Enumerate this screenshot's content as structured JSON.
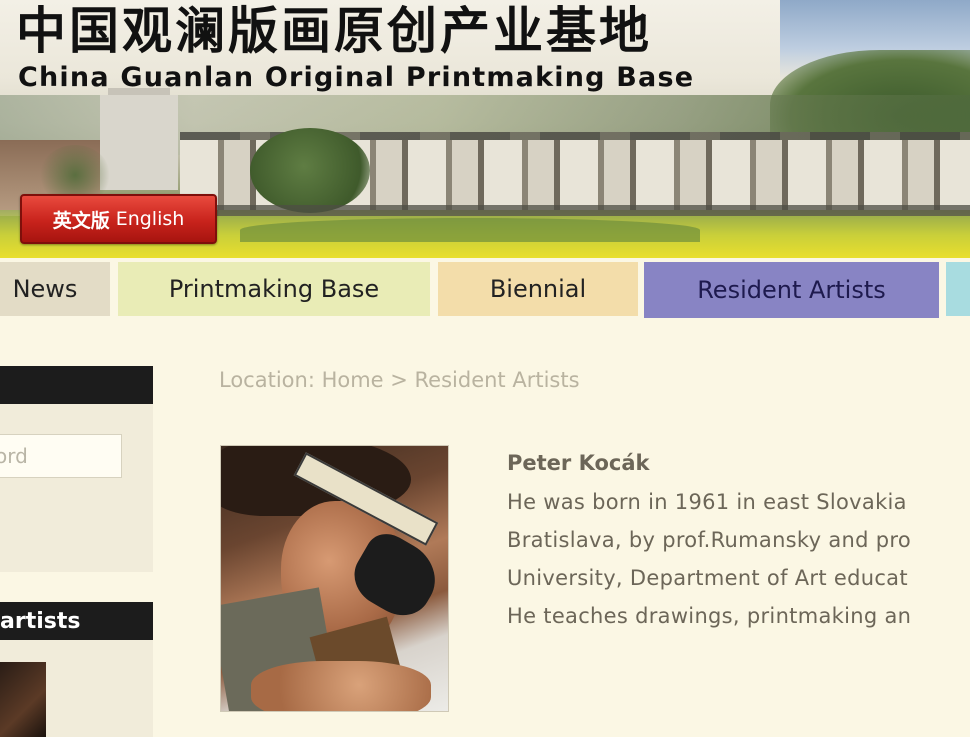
{
  "header": {
    "title_cn": "中国观澜版画原创产业基地",
    "title_en": "China Guanlan Original Printmaking Base",
    "language_button": {
      "cn": "英文版",
      "en": "English"
    }
  },
  "nav": {
    "tabs": [
      {
        "label": "News",
        "color": "#e3dcc6"
      },
      {
        "label": "Printmaking Base",
        "color": "#e9ecb6"
      },
      {
        "label": "Biennial",
        "color": "#f3ddaa"
      },
      {
        "label": "Resident Artists",
        "color": "#8884c4",
        "active": true
      },
      {
        "label": "",
        "color": "#a8dce0"
      }
    ]
  },
  "sidebar": {
    "search": {
      "placeholder": "ord"
    },
    "section_artists": "artists"
  },
  "main": {
    "breadcrumb": "Location: Home > Resident Artists",
    "artist": {
      "name": "Peter Kocák",
      "bio_lines": [
        "He was born in 1961 in east Slovakia",
        "Bratislava, by prof.Rumansky and pro",
        "University, Department of Art educat",
        "He teaches drawings, printmaking an"
      ]
    }
  },
  "colors": {
    "page_bg": "#fbf7e4",
    "sidebar_heading_bg": "#1c1c1c",
    "language_button": "#c8231c",
    "text_muted": "#6c6658"
  }
}
